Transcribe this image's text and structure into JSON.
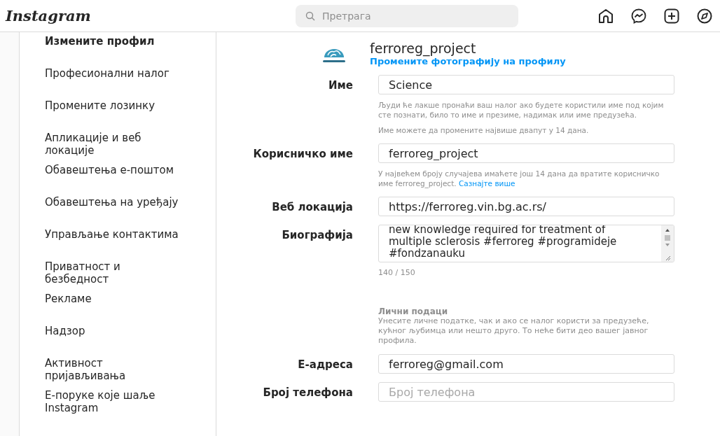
{
  "header": {
    "logo": "Instagram",
    "search": {
      "placeholder": "Претрага"
    }
  },
  "sidebar": {
    "items": [
      {
        "label": "Измените профил",
        "selected": true
      },
      {
        "label": "Професионални налог",
        "selected": false
      },
      {
        "label": "Промените лозинку",
        "selected": false
      },
      {
        "label": "Апликације и веб локације",
        "selected": false
      },
      {
        "label": "Обавештења е-поштом",
        "selected": false
      },
      {
        "label": "Обавештења на уређају",
        "selected": false
      },
      {
        "label": "Управљање контактима",
        "selected": false
      },
      {
        "label": "Приватност и безбедност",
        "selected": false
      },
      {
        "label": "Рекламе",
        "selected": false
      },
      {
        "label": "Надзор",
        "selected": false
      },
      {
        "label": "Активност пријављивања",
        "selected": false
      },
      {
        "label": "Е-поруке које шаље Instagram",
        "selected": false
      }
    ]
  },
  "profile": {
    "username": "ferroreg_project",
    "change_photo": "Промените фотографију на профилу"
  },
  "form": [
    {
      "kind": "input",
      "label": "Име",
      "value": "Science",
      "hints": [
        "Људи ће лакше пронаћи ваш налог ако будете користили име под којим сте познати, било то име и презиме, надимак или име предузећа.",
        "Име можете да промените највише двапут у 14 дана."
      ]
    },
    {
      "kind": "input",
      "label": "Корисничко име",
      "value": "ferroreg_project",
      "hints": [
        "У највећем броју случајева имаћете још 14 дана да вратите корисничко име ferroreg_project."
      ],
      "link": "Сазнајте више"
    },
    {
      "kind": "input",
      "label": "Веб локација",
      "value": "https://ferroreg.vin.bg.ac.rs/"
    },
    {
      "kind": "textarea",
      "label": "Биографија",
      "value": "new knowledge required for treatment of multiple sclerosis #ferroreg #programideje #fondzanauku",
      "counter": "140 / 150"
    },
    {
      "kind": "section",
      "title": "Лични подаци",
      "text": "Унесите личне податке, чак и ако се налог користи за предузеће, кућног љубимца или нешто друго. То неће бити део вашег јавног профила."
    },
    {
      "kind": "input",
      "label": "Е-адреса",
      "value": "ferroreg@gmail.com"
    },
    {
      "kind": "input",
      "label": "Број телефона",
      "placeholder": "Број телефона"
    }
  ]
}
